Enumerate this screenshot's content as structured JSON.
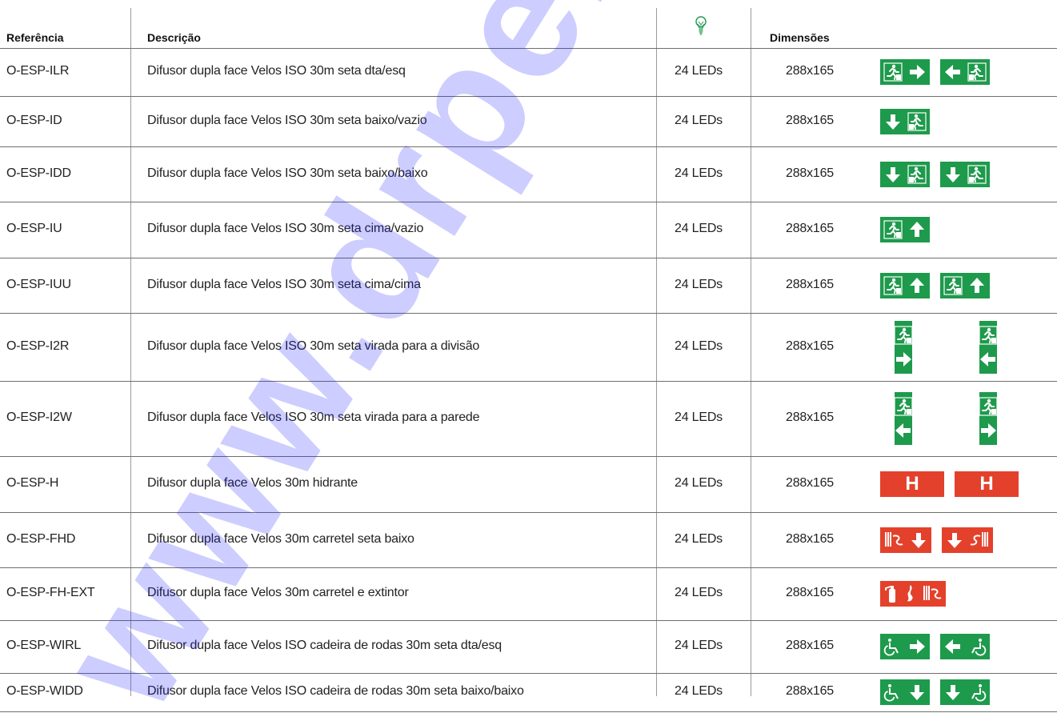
{
  "headers": {
    "ref": "Referência",
    "desc": "Descrição",
    "leds_icon": "lightbulb-icon",
    "dims": "Dimensões"
  },
  "colors": {
    "green": "#1e9a4c",
    "red": "#e3412b",
    "watermark": "#1a1aff"
  },
  "watermark": "www.drpeixe",
  "rows": [
    {
      "ref": "O-ESP-ILR",
      "desc": "Difusor dupla face Velos ISO 30m seta dta/esq",
      "leds": "24 LEDs",
      "dims": "288x165",
      "signs": [
        "exit-right",
        "exit-left"
      ]
    },
    {
      "ref": "O-ESP-ID",
      "desc": "Difusor dupla face Velos ISO 30m seta baixo/vazio",
      "leds": "24 LEDs",
      "dims": "288x165",
      "signs": [
        "exit-down"
      ]
    },
    {
      "ref": "O-ESP-IDD",
      "desc": "Difusor dupla face Velos ISO 30m seta baixo/baixo",
      "leds": "24 LEDs",
      "dims": "288x165",
      "signs": [
        "exit-down",
        "exit-down"
      ]
    },
    {
      "ref": "O-ESP-IU",
      "desc": "Difusor dupla face Velos ISO 30m seta cima/vazio",
      "leds": "24 LEDs",
      "dims": "288x165",
      "signs": [
        "exit-up"
      ]
    },
    {
      "ref": "O-ESP-IUU",
      "desc": "Difusor dupla face Velos ISO 30m seta cima/cima",
      "leds": "24 LEDs",
      "dims": "288x165",
      "signs": [
        "exit-up",
        "exit-up"
      ]
    },
    {
      "ref": "O-ESP-I2R",
      "desc": "Difusor dupla face Velos ISO 30m seta virada para a divisão",
      "leds": "24 LEDs",
      "dims": "288x165",
      "signs": [
        "exit-vertical-right",
        "exit-vertical-left"
      ]
    },
    {
      "ref": "O-ESP-I2W",
      "desc": "Difusor dupla face Velos ISO 30m seta virada para a parede",
      "leds": "24 LEDs",
      "dims": "288x165",
      "signs": [
        "exit-vertical-left",
        "exit-vertical-right"
      ]
    },
    {
      "ref": "O-ESP-H",
      "desc": "Difusor dupla face Velos 30m hidrante",
      "leds": "24 LEDs",
      "dims": "288x165",
      "signs": [
        "hydrant",
        "hydrant"
      ]
    },
    {
      "ref": "O-ESP-FHD",
      "desc": "Difusor dupla face Velos 30m carretel seta baixo",
      "leds": "24 LEDs",
      "dims": "288x165",
      "signs": [
        "hose-down",
        "down-hose"
      ]
    },
    {
      "ref": "O-ESP-FH-EXT",
      "desc": "Difusor dupla face Velos 30m carretel e extintor",
      "leds": "24 LEDs",
      "dims": "288x165",
      "signs": [
        "extinguisher-hose"
      ]
    },
    {
      "ref": "O-ESP-WIRL",
      "desc": "Difusor dupla face Velos ISO cadeira de rodas 30m seta dta/esq",
      "leds": "24 LEDs",
      "dims": "288x165",
      "signs": [
        "wheelchair-right",
        "wheelchair-left"
      ]
    },
    {
      "ref": "O-ESP-WIDD",
      "desc": "Difusor dupla face Velos ISO cadeira de rodas 30m seta baixo/baixo",
      "leds": "24 LEDs",
      "dims": "288x165",
      "signs": [
        "wheelchair-down",
        "down-wheelchair"
      ]
    }
  ]
}
